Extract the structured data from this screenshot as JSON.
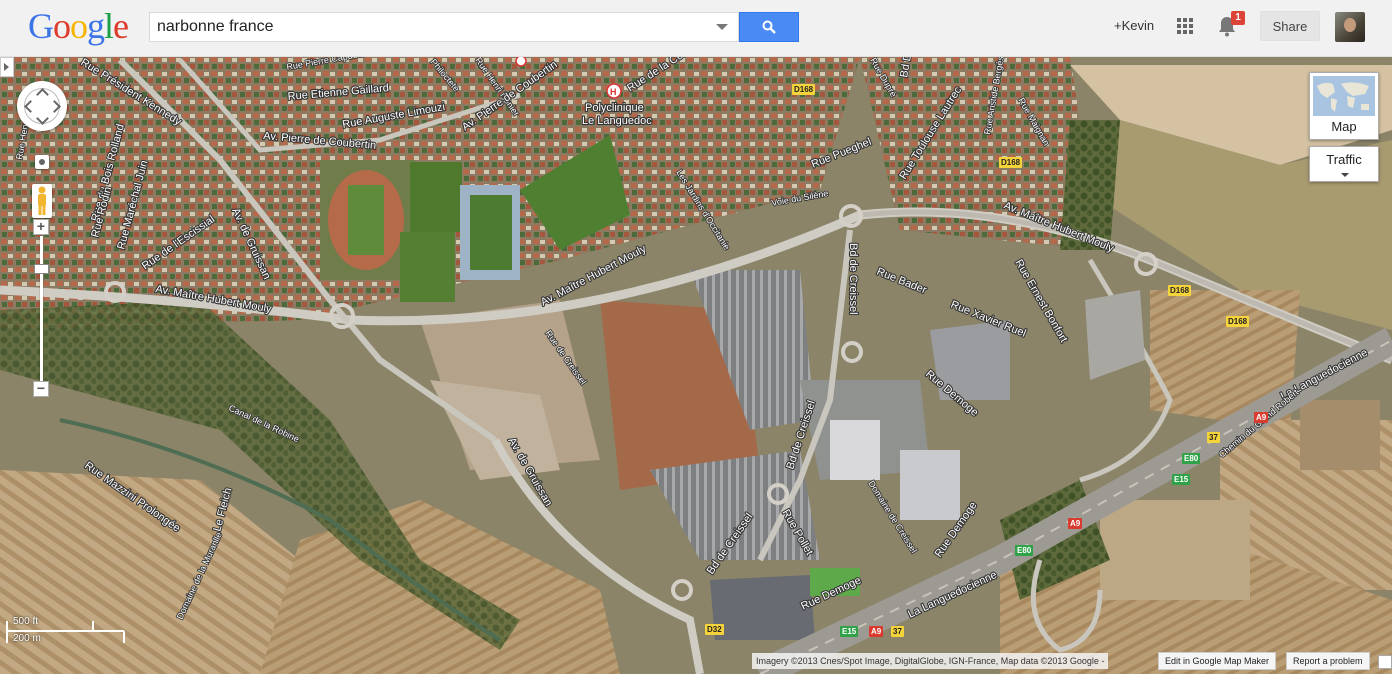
{
  "header": {
    "logo_letters": [
      {
        "ch": "G",
        "color": "#3b74e8"
      },
      {
        "ch": "o",
        "color": "#dd3b2a"
      },
      {
        "ch": "o",
        "color": "#f4b400"
      },
      {
        "ch": "g",
        "color": "#3b74e8"
      },
      {
        "ch": "l",
        "color": "#199f46"
      },
      {
        "ch": "e",
        "color": "#dd3b2a"
      }
    ],
    "search_value": "narbonne france",
    "search_icon": "magnifier-icon",
    "user_link": "+Kevin",
    "notification_count": "1",
    "share_label": "Share"
  },
  "map": {
    "map_type_label": "Map",
    "traffic_label": "Traffic",
    "scale_ft": "500 ft",
    "scale_m": "200 m",
    "attribution": "Imagery ©2013 Cnes/Spot Image, DigitalGlobe, IGN-France, Map data ©2013 Google -",
    "edit_label": "Edit in Google Map Maker",
    "report_label": "Report a problem",
    "labels": [
      "Rue Président Kennedy",
      "Rue Pierre Capdeville",
      "Philoctete",
      "Rue Henri Nonier",
      "Rue Etienne Gaillard",
      "Rue Auguste Limouzi",
      "Av. Pierre de Coubertin",
      "Av. Pierre de Coubertin",
      "Polyclinique",
      "Le Languedoc",
      "Rue de la Côte des Roses",
      "Rue Dupré",
      "Bd Dr Ferroul",
      "Rue Aristide Bergès",
      "Rue Pueghel",
      "Rue Toulouse Lautrec",
      "Av. Maître Hubert Mouly",
      "Av. Maître Hubert Mouly",
      "Av. Maître Hubert Mouly",
      "Les Jardins d'Occitanie",
      "Voie du Silène",
      "Rue Ernest Bonfort",
      "Rue Bader",
      "Bd de Creissel",
      "Rue Xavier Ruel",
      "Rue Demoge",
      "Rue de Creissel",
      "Av. de Gruissan",
      "Av. de Gruissan",
      "Rue Maréchal Juin",
      "Rue du Bois Rolland",
      "Rue Rodin",
      "Rue de l'Escissial",
      "Canal de la Robine",
      "Rue Mazzini Prolongée",
      "Le Fleich",
      "Domaine de la Muranlle",
      "Bd de Creissel",
      "Bd de Creissel",
      "Rue Pollet",
      "Domaine de Creissel",
      "Rue Demoge",
      "Rue Demoge",
      "La Languedocienne",
      "La Languedocienne",
      "Chemin du Grand Robert",
      "Rue Maignan",
      "Rue Henri Gouzy"
    ],
    "road_signs": [
      {
        "text": "D168",
        "bg": "#f5d33b"
      },
      {
        "text": "D168",
        "bg": "#f5d33b"
      },
      {
        "text": "D168",
        "bg": "#f5d33b"
      },
      {
        "text": "D168",
        "bg": "#f5d33b"
      },
      {
        "text": "A9",
        "bg": "#d93b2e"
      },
      {
        "text": "37",
        "bg": "#f5d33b"
      },
      {
        "text": "E80",
        "bg": "#2fa24a"
      },
      {
        "text": "E15",
        "bg": "#2fa24a"
      },
      {
        "text": "A9",
        "bg": "#d93b2e"
      },
      {
        "text": "E80",
        "bg": "#2fa24a"
      },
      {
        "text": "D32",
        "bg": "#f5d33b"
      },
      {
        "text": "E15",
        "bg": "#2fa24a"
      },
      {
        "text": "A9",
        "bg": "#d93b2e"
      },
      {
        "text": "37",
        "bg": "#f5d33b"
      }
    ]
  }
}
